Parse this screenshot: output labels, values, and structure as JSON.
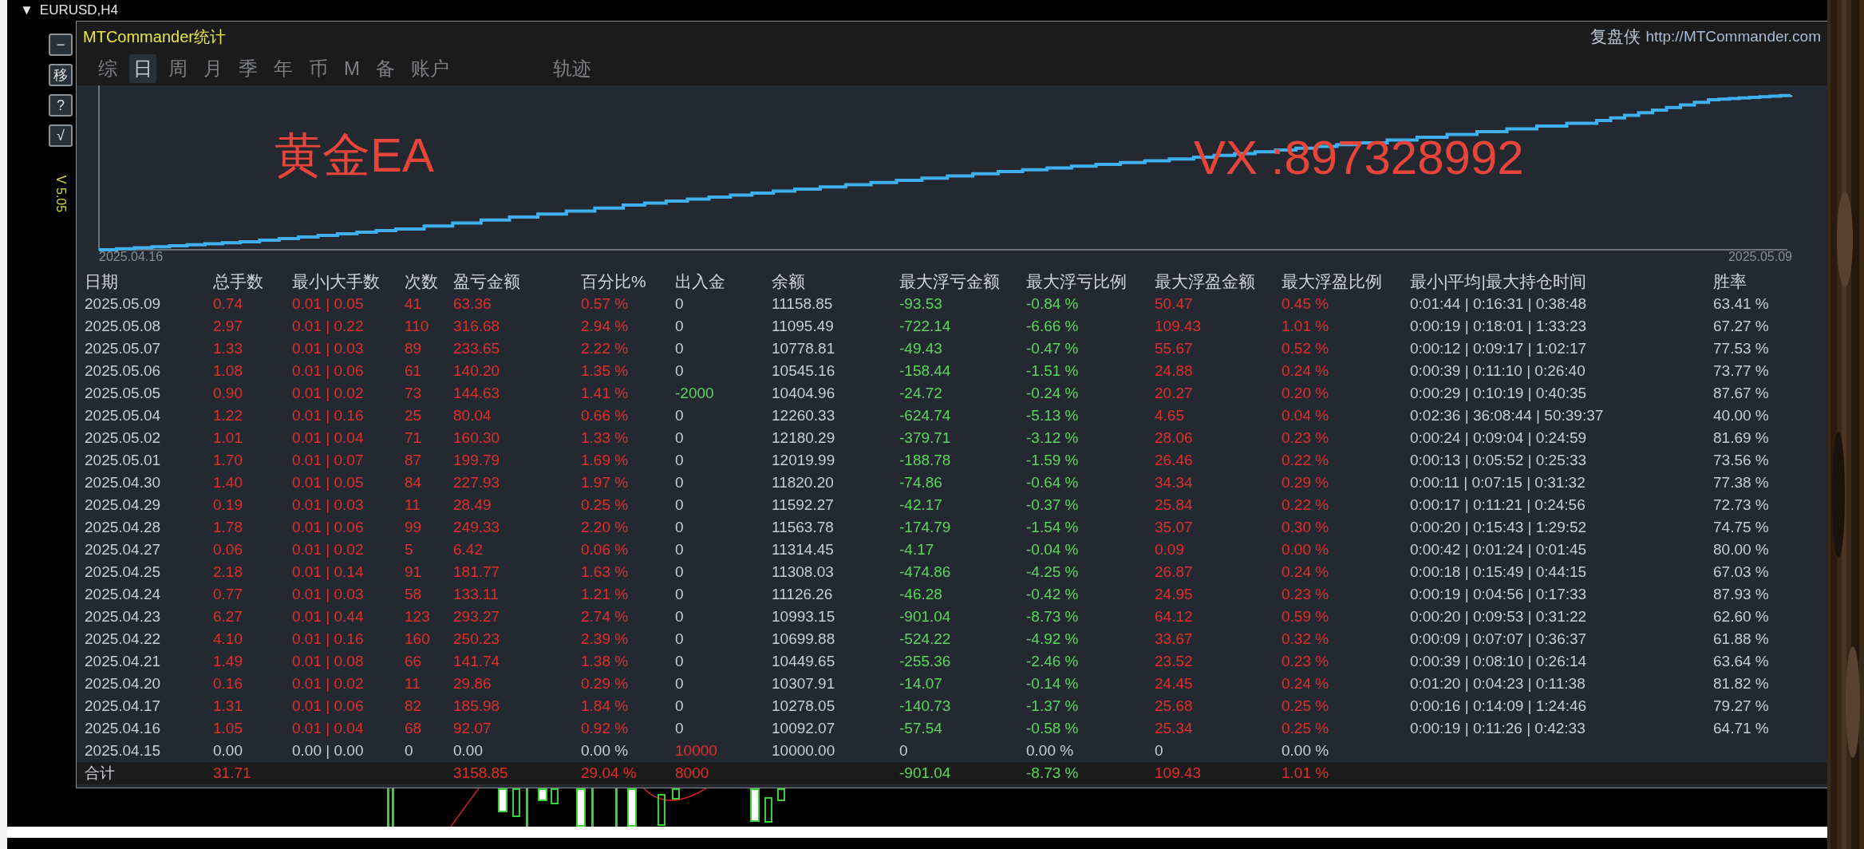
{
  "symbol_bar": {
    "arrow": "▼",
    "symbol": "EURUSD,H4"
  },
  "side_buttons": [
    "−",
    "移",
    "?",
    "√"
  ],
  "version": "V 5.05",
  "panel": {
    "title": "MTCommander统计",
    "brand": "复盘侠",
    "link": "http://MTCommander.com",
    "tabs": [
      {
        "label": "综",
        "selected": false
      },
      {
        "label": "日",
        "selected": true
      },
      {
        "label": "周",
        "selected": false
      },
      {
        "label": "月",
        "selected": false
      },
      {
        "label": "季",
        "selected": false
      },
      {
        "label": "年",
        "selected": false
      },
      {
        "label": "币",
        "selected": false
      },
      {
        "label": "M",
        "selected": false
      },
      {
        "label": "备",
        "selected": false
      },
      {
        "label": "账户",
        "selected": false
      }
    ],
    "trail_tab": {
      "label": "轨迹",
      "selected": false
    },
    "chart": {
      "start_label": "2025.04.16",
      "end_label": "2025.05.09",
      "overlay_left": "黄金EA",
      "overlay_right": "VX :897328992"
    },
    "table": {
      "columns": [
        {
          "label": "日期",
          "color": "#c8ccd4"
        },
        {
          "label": "总手数",
          "color": "#e0302a"
        },
        {
          "label": "最小|大手数",
          "color": "#e0302a"
        },
        {
          "label": "次数",
          "color": "#e0302a"
        },
        {
          "label": "盈亏金额",
          "color": "#e0302a"
        },
        {
          "label": "百分比%",
          "color": "#e0302a"
        },
        {
          "label": "出入金",
          "color": "#c8ccd4"
        },
        {
          "label": "余额",
          "color": "#c8ccd4"
        },
        {
          "label": "最大浮亏金额",
          "color": "#5cd65c"
        },
        {
          "label": "最大浮亏比例",
          "color": "#5cd65c"
        },
        {
          "label": "最大浮盈金额",
          "color": "#e0302a"
        },
        {
          "label": "最大浮盈比例",
          "color": "#e0302a"
        },
        {
          "label": "最小|平均|最大持仓时间",
          "color": "#c8ccd4"
        },
        {
          "label": "胜率",
          "color": "#c8ccd4"
        }
      ],
      "rows": [
        {
          "cells": [
            "2025.05.09",
            "0.74",
            "0.01 | 0.05",
            "41",
            "63.36",
            "0.57 %",
            "0",
            "11158.85",
            "-93.53",
            "-0.84 %",
            "50.47",
            "0.45 %",
            "0:01:44 | 0:16:31 | 0:38:48",
            "63.41 %"
          ]
        },
        {
          "cells": [
            "2025.05.08",
            "2.97",
            "0.01 | 0.22",
            "110",
            "316.68",
            "2.94 %",
            "0",
            "11095.49",
            "-722.14",
            "-6.66 %",
            "109.43",
            "1.01 %",
            "0:00:19 | 0:18:01 | 1:33:23",
            "67.27 %"
          ]
        },
        {
          "cells": [
            "2025.05.07",
            "1.33",
            "0.01 | 0.03",
            "89",
            "233.65",
            "2.22 %",
            "0",
            "10778.81",
            "-49.43",
            "-0.47 %",
            "55.67",
            "0.52 %",
            "0:00:12 | 0:09:17 | 1:02:17",
            "77.53 %"
          ]
        },
        {
          "cells": [
            "2025.05.06",
            "1.08",
            "0.01 | 0.06",
            "61",
            "140.20",
            "1.35 %",
            "0",
            "10545.16",
            "-158.44",
            "-1.51 %",
            "24.88",
            "0.24 %",
            "0:00:39 | 0:11:10 | 0:26:40",
            "73.77 %"
          ]
        },
        {
          "cells": [
            "2025.05.05",
            "0.90",
            "0.01 | 0.02",
            "73",
            "144.63",
            "1.41 %",
            {
              "text": "-2000",
              "color": "#5cd65c"
            },
            "10404.96",
            "-24.72",
            "-0.24 %",
            "20.27",
            "0.20 %",
            "0:00:29 | 0:10:19 | 0:40:35",
            "87.67 %"
          ]
        },
        {
          "cells": [
            "2025.05.04",
            "1.22",
            "0.01 | 0.16",
            "25",
            "80.04",
            "0.66 %",
            "0",
            "12260.33",
            "-624.74",
            "-5.13 %",
            "4.65",
            "0.04 %",
            "0:02:36 | 36:08:44 | 50:39:37",
            "40.00 %"
          ]
        },
        {
          "cells": [
            "2025.05.02",
            "1.01",
            "0.01 | 0.04",
            "71",
            "160.30",
            "1.33 %",
            "0",
            "12180.29",
            "-379.71",
            "-3.12 %",
            "28.06",
            "0.23 %",
            "0:00:24 | 0:09:04 | 0:24:59",
            "81.69 %"
          ]
        },
        {
          "cells": [
            "2025.05.01",
            "1.70",
            "0.01 | 0.07",
            "87",
            "199.79",
            "1.69 %",
            "0",
            "12019.99",
            "-188.78",
            "-1.59 %",
            "26.46",
            "0.22 %",
            "0:00:13 | 0:05:52 | 0:25:33",
            "73.56 %"
          ]
        },
        {
          "cells": [
            "2025.04.30",
            "1.40",
            "0.01 | 0.05",
            "84",
            "227.93",
            "1.97 %",
            "0",
            "11820.20",
            "-74.86",
            "-0.64 %",
            "34.34",
            "0.29 %",
            "0:00:11 | 0:07:15 | 0:31:32",
            "77.38 %"
          ]
        },
        {
          "cells": [
            "2025.04.29",
            "0.19",
            "0.01 | 0.03",
            "11",
            "28.49",
            "0.25 %",
            "0",
            "11592.27",
            "-42.17",
            "-0.37 %",
            "25.84",
            "0.22 %",
            "0:00:17 | 0:11:21 | 0:24:56",
            "72.73 %"
          ]
        },
        {
          "cells": [
            "2025.04.28",
            "1.78",
            "0.01 | 0.06",
            "99",
            "249.33",
            "2.20 %",
            "0",
            "11563.78",
            "-174.79",
            "-1.54 %",
            "35.07",
            "0.30 %",
            "0:00:20 | 0:15:43 | 1:29:52",
            "74.75 %"
          ]
        },
        {
          "cells": [
            "2025.04.27",
            "0.06",
            "0.01 | 0.02",
            "5",
            "6.42",
            "0.06 %",
            "0",
            "11314.45",
            "-4.17",
            "-0.04 %",
            "0.09",
            "0.00 %",
            "0:00:42 | 0:01:24 | 0:01:45",
            "80.00 %"
          ]
        },
        {
          "cells": [
            "2025.04.25",
            "2.18",
            "0.01 | 0.14",
            "91",
            "181.77",
            "1.63 %",
            "0",
            "11308.03",
            "-474.86",
            "-4.25 %",
            "26.87",
            "0.24 %",
            "0:00:18 | 0:15:49 | 0:44:15",
            "67.03 %"
          ]
        },
        {
          "cells": [
            "2025.04.24",
            "0.77",
            "0.01 | 0.03",
            "58",
            "133.11",
            "1.21 %",
            "0",
            "11126.26",
            "-46.28",
            "-0.42 %",
            "24.95",
            "0.23 %",
            "0:00:19 | 0:04:56 | 0:17:33",
            "87.93 %"
          ]
        },
        {
          "cells": [
            "2025.04.23",
            "6.27",
            "0.01 | 0.44",
            "123",
            "293.27",
            "2.74 %",
            "0",
            "10993.15",
            "-901.04",
            "-8.73 %",
            "64.12",
            "0.59 %",
            "0:00:20 | 0:09:53 | 0:31:22",
            "62.60 %"
          ]
        },
        {
          "cells": [
            "2025.04.22",
            "4.10",
            "0.01 | 0.16",
            "160",
            "250.23",
            "2.39 %",
            "0",
            "10699.88",
            "-524.22",
            "-4.92 %",
            "33.67",
            "0.32 %",
            "0:00:09 | 0:07:07 | 0:36:37",
            "61.88 %"
          ]
        },
        {
          "cells": [
            "2025.04.21",
            "1.49",
            "0.01 | 0.08",
            "66",
            "141.74",
            "1.38 %",
            "0",
            "10449.65",
            "-255.36",
            "-2.46 %",
            "23.52",
            "0.23 %",
            "0:00:39 | 0:08:10 | 0:26:14",
            "63.64 %"
          ]
        },
        {
          "cells": [
            "2025.04.20",
            "0.16",
            "0.01 | 0.02",
            "11",
            "29.86",
            "0.29 %",
            "0",
            "10307.91",
            "-14.07",
            "-0.14 %",
            "24.45",
            "0.24 %",
            "0:01:20 | 0:04:23 | 0:11:38",
            "81.82 %"
          ]
        },
        {
          "cells": [
            "2025.04.17",
            "1.31",
            "0.01 | 0.06",
            "82",
            "185.98",
            "1.84 %",
            "0",
            "10278.05",
            "-140.73",
            "-1.37 %",
            "25.68",
            "0.25 %",
            "0:00:16 | 0:14:09 | 1:24:46",
            "79.27 %"
          ]
        },
        {
          "cells": [
            "2025.04.16",
            "1.05",
            "0.01 | 0.04",
            "68",
            "92.07",
            "0.92 %",
            "0",
            "10092.07",
            "-57.54",
            "-0.58 %",
            "25.34",
            "0.25 %",
            "0:00:19 | 0:11:26 | 0:42:33",
            "64.71 %"
          ]
        },
        {
          "cells": [
            "2025.04.15",
            {
              "text": "0.00",
              "color": "#c8ccd4"
            },
            {
              "text": "0.00 | 0.00",
              "color": "#c8ccd4"
            },
            {
              "text": "0",
              "color": "#c8ccd4"
            },
            {
              "text": "0.00",
              "color": "#c8ccd4"
            },
            {
              "text": "0.00 %",
              "color": "#c8ccd4"
            },
            {
              "text": "10000",
              "color": "#e0302a"
            },
            "10000.00",
            {
              "text": "0",
              "color": "#c8ccd4"
            },
            {
              "text": "0.00 %",
              "color": "#c8ccd4"
            },
            {
              "text": "0",
              "color": "#c8ccd4"
            },
            {
              "text": "0.00 %",
              "color": "#c8ccd4"
            }
          ]
        }
      ],
      "total": {
        "cells": [
          "合计",
          "31.71",
          null,
          null,
          "3158.85",
          "29.04 %",
          {
            "text": "8000",
            "color": "#e0302a"
          },
          null,
          "-901.04",
          "-8.73 %",
          "109.43",
          "1.01 %"
        ]
      }
    }
  }
}
